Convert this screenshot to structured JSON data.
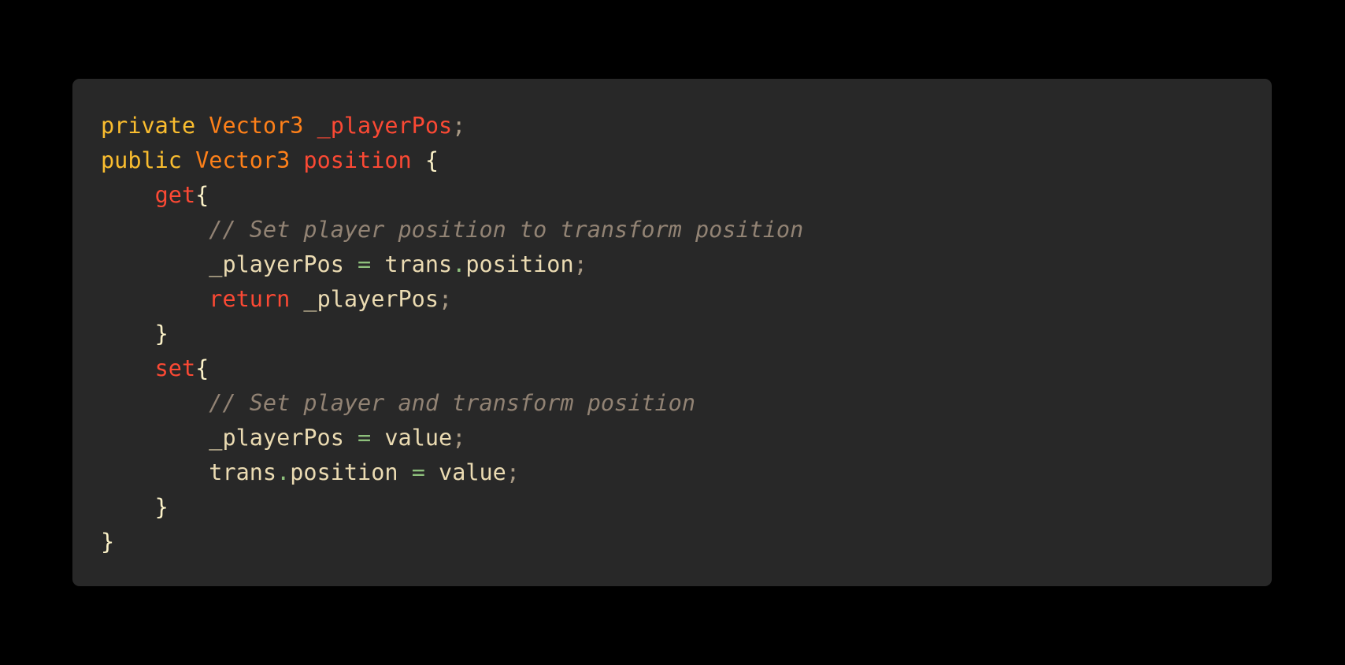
{
  "colors": {
    "page_background": "#000000",
    "card_background": "#282828",
    "keyword_modifier": "#fabd2f",
    "type": "#fe8019",
    "identifier_declared": "#fb4934",
    "keyword_control": "#fb4934",
    "text": "#ebdbb2",
    "punctuation": "#a89984",
    "operator": "#8ec07c",
    "comment": "#928374"
  },
  "code": {
    "lines": [
      [
        {
          "t": "private",
          "k": "kw-orange"
        },
        {
          "t": " ",
          "k": "plain"
        },
        {
          "t": "Vector3",
          "k": "ty"
        },
        {
          "t": " ",
          "k": "plain"
        },
        {
          "t": "_playerPos",
          "k": "id-red"
        },
        {
          "t": ";",
          "k": "punct"
        }
      ],
      [
        {
          "t": "public",
          "k": "kw-orange"
        },
        {
          "t": " ",
          "k": "plain"
        },
        {
          "t": "Vector3",
          "k": "ty"
        },
        {
          "t": " ",
          "k": "plain"
        },
        {
          "t": "position",
          "k": "id-red"
        },
        {
          "t": " ",
          "k": "plain"
        },
        {
          "t": "{",
          "k": "brace"
        }
      ],
      [
        {
          "t": "    ",
          "k": "plain"
        },
        {
          "t": "get",
          "k": "kw-red"
        },
        {
          "t": "{",
          "k": "brace"
        }
      ],
      [
        {
          "t": "        ",
          "k": "plain"
        },
        {
          "t": "// Set player position to transform position",
          "k": "comment"
        }
      ],
      [
        {
          "t": "        ",
          "k": "plain"
        },
        {
          "t": "_playerPos",
          "k": "plain"
        },
        {
          "t": " ",
          "k": "plain"
        },
        {
          "t": "=",
          "k": "op"
        },
        {
          "t": " ",
          "k": "plain"
        },
        {
          "t": "trans",
          "k": "plain"
        },
        {
          "t": ".",
          "k": "op"
        },
        {
          "t": "position",
          "k": "plain"
        },
        {
          "t": ";",
          "k": "punct"
        }
      ],
      [
        {
          "t": "        ",
          "k": "plain"
        },
        {
          "t": "return",
          "k": "kw-red"
        },
        {
          "t": " ",
          "k": "plain"
        },
        {
          "t": "_playerPos",
          "k": "plain"
        },
        {
          "t": ";",
          "k": "punct"
        }
      ],
      [
        {
          "t": "    ",
          "k": "plain"
        },
        {
          "t": "}",
          "k": "brace"
        }
      ],
      [
        {
          "t": "    ",
          "k": "plain"
        },
        {
          "t": "set",
          "k": "kw-red"
        },
        {
          "t": "{",
          "k": "brace"
        }
      ],
      [
        {
          "t": "        ",
          "k": "plain"
        },
        {
          "t": "// Set player and transform position",
          "k": "comment"
        }
      ],
      [
        {
          "t": "        ",
          "k": "plain"
        },
        {
          "t": "_playerPos",
          "k": "plain"
        },
        {
          "t": " ",
          "k": "plain"
        },
        {
          "t": "=",
          "k": "op"
        },
        {
          "t": " ",
          "k": "plain"
        },
        {
          "t": "value",
          "k": "plain"
        },
        {
          "t": ";",
          "k": "punct"
        }
      ],
      [
        {
          "t": "        ",
          "k": "plain"
        },
        {
          "t": "trans",
          "k": "plain"
        },
        {
          "t": ".",
          "k": "op"
        },
        {
          "t": "position",
          "k": "plain"
        },
        {
          "t": " ",
          "k": "plain"
        },
        {
          "t": "=",
          "k": "op"
        },
        {
          "t": " ",
          "k": "plain"
        },
        {
          "t": "value",
          "k": "plain"
        },
        {
          "t": ";",
          "k": "punct"
        }
      ],
      [
        {
          "t": "    ",
          "k": "plain"
        },
        {
          "t": "}",
          "k": "brace"
        }
      ],
      [
        {
          "t": "}",
          "k": "brace"
        }
      ]
    ]
  }
}
